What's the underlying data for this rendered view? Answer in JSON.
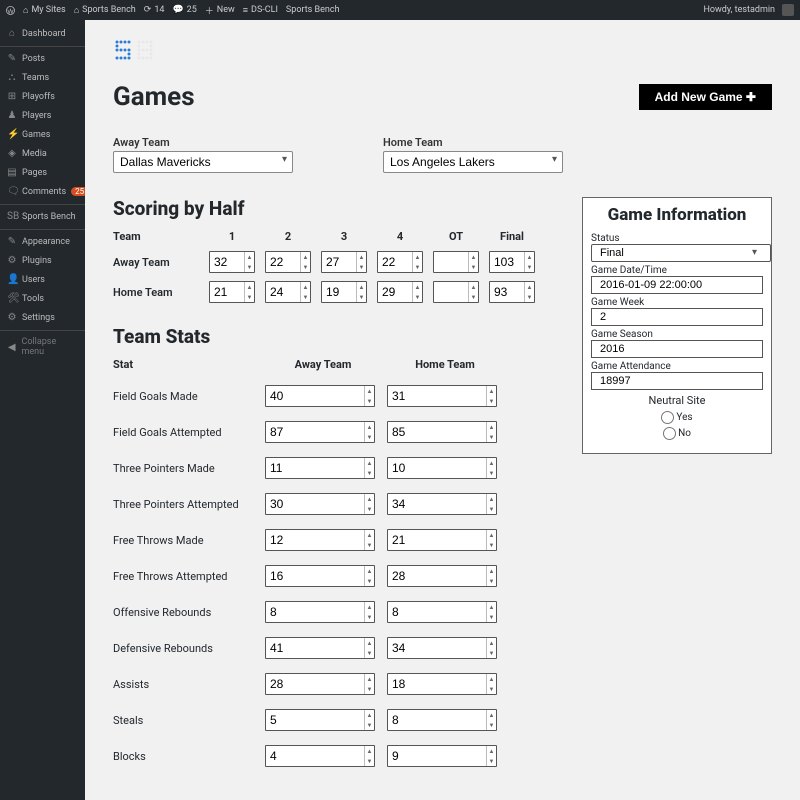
{
  "adminbar": {
    "my_sites": "My Sites",
    "site_name": "Sports Bench",
    "updates": "14",
    "comments": "25",
    "new": "New",
    "ds_cli": "DS-CLI",
    "sports_bench": "Sports Bench",
    "howdy": "Howdy, testadmin"
  },
  "sidebar": {
    "dashboard": "Dashboard",
    "posts": "Posts",
    "teams": "Teams",
    "playoffs": "Playoffs",
    "players": "Players",
    "games": "Games",
    "media": "Media",
    "pages": "Pages",
    "comments": "Comments",
    "comments_badge": "25",
    "sports_bench": "Sports Bench",
    "appearance": "Appearance",
    "plugins": "Plugins",
    "users": "Users",
    "tools": "Tools",
    "settings": "Settings",
    "collapse": "Collapse menu"
  },
  "page": {
    "title": "Games",
    "add_new": "Add New Game ✚"
  },
  "teams": {
    "away_label": "Away Team",
    "home_label": "Home Team",
    "away_selected": "Dallas Mavericks",
    "home_selected": "Los Angeles Lakers"
  },
  "scoring": {
    "heading": "Scoring by Half",
    "col_team": "Team",
    "cols": [
      "1",
      "2",
      "3",
      "4",
      "OT",
      "Final"
    ],
    "row_away": "Away Team",
    "row_home": "Home Team",
    "away": [
      "32",
      "22",
      "27",
      "22",
      "",
      "103"
    ],
    "home": [
      "21",
      "24",
      "19",
      "29",
      "",
      "93"
    ]
  },
  "team_stats": {
    "heading": "Team Stats",
    "col_stat": "Stat",
    "col_away": "Away Team",
    "col_home": "Home Team",
    "rows": [
      {
        "name": "Field Goals Made",
        "away": "40",
        "home": "31"
      },
      {
        "name": "Field Goals Attempted",
        "away": "87",
        "home": "85"
      },
      {
        "name": "Three Pointers Made",
        "away": "11",
        "home": "10"
      },
      {
        "name": "Three Pointers Attempted",
        "away": "30",
        "home": "34"
      },
      {
        "name": "Free Throws Made",
        "away": "12",
        "home": "21"
      },
      {
        "name": "Free Throws Attempted",
        "away": "16",
        "home": "28"
      },
      {
        "name": "Offensive Rebounds",
        "away": "8",
        "home": "8"
      },
      {
        "name": "Defensive Rebounds",
        "away": "41",
        "home": "34"
      },
      {
        "name": "Assists",
        "away": "28",
        "home": "18"
      },
      {
        "name": "Steals",
        "away": "5",
        "home": "8"
      },
      {
        "name": "Blocks",
        "away": "4",
        "home": "9"
      }
    ]
  },
  "game_info": {
    "heading": "Game Information",
    "status_label": "Status",
    "status": "Final",
    "datetime_label": "Game Date/Time",
    "datetime": "2016-01-09 22:00:00",
    "week_label": "Game Week",
    "week": "2",
    "season_label": "Game Season",
    "season": "2016",
    "attendance_label": "Game Attendance",
    "attendance": "18997",
    "neutral_label": "Neutral Site",
    "yes": "Yes",
    "no": "No"
  }
}
